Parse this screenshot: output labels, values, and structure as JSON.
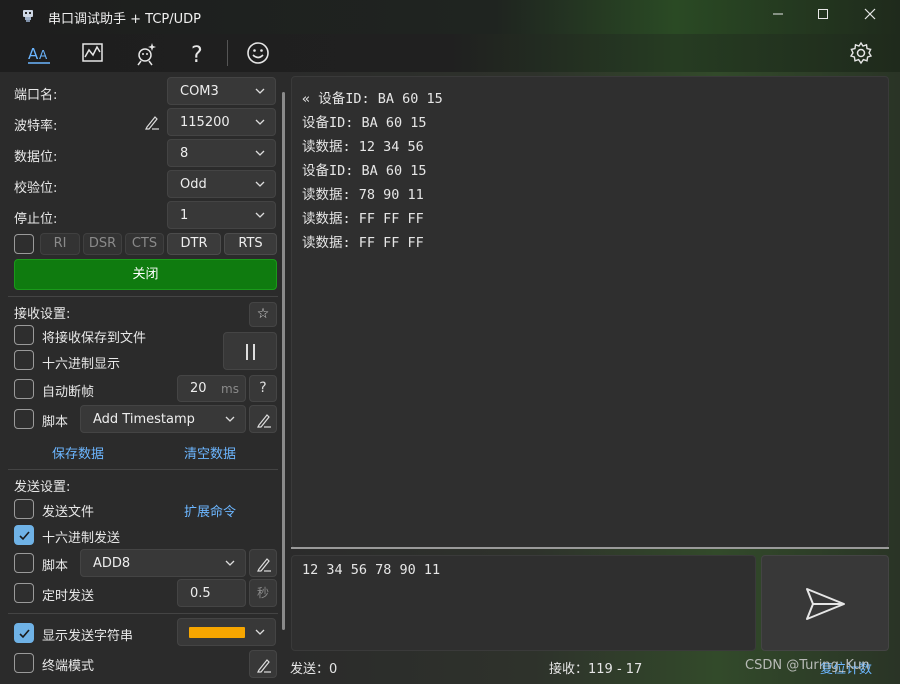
{
  "window": {
    "title": "串口调试助手 + TCP/UDP",
    "controls": [
      "minimize-icon",
      "maximize-icon",
      "close-icon"
    ]
  },
  "toolbar": {
    "icons": [
      "font-icon",
      "chart-icon",
      "magic-icon",
      "help-icon",
      "smiley-icon",
      "gear-icon"
    ],
    "help_glyph": "?"
  },
  "serial": {
    "port_label": "端口名:",
    "port_value": "COM3",
    "baud_label": "波特率:",
    "baud_value": "115200",
    "databits_label": "数据位:",
    "databits_value": "8",
    "parity_label": "校验位:",
    "parity_value": "Odd",
    "stopbits_label": "停止位:",
    "stopbits_value": "1",
    "signals": [
      "RI",
      "DSR",
      "CTS",
      "DTR",
      "RTS"
    ],
    "close_label": "关闭"
  },
  "receive_settings": {
    "title": "接收设置:",
    "save_to_file": "将接收保存到文件",
    "hex_display": "十六进制显示",
    "auto_frame": "自动断帧",
    "auto_frame_value": "20",
    "auto_frame_unit": "ms",
    "help_glyph": "?",
    "script_label": "脚本",
    "script_value": "Add Timestamp",
    "save_data": "保存数据",
    "clear_data": "清空数据"
  },
  "send_settings": {
    "title": "发送设置:",
    "send_file": "发送文件",
    "extend_cmd": "扩展命令",
    "hex_send": "十六进制发送",
    "hex_send_checked": true,
    "script_label": "脚本",
    "script_value": "ADD8",
    "timed_send": "定时发送",
    "timed_value": "0.5",
    "timed_unit": "秒",
    "show_send_string": "显示发送字符串",
    "show_send_checked": true,
    "send_color": "#f7a600",
    "terminal_mode": "终端模式"
  },
  "receive_lines": [
    "« 设备ID: BA 60 15",
    "设备ID: BA 60 15",
    "读数据: 12 34 56",
    "设备ID: BA 60 15",
    "读数据: 78 90 11",
    "读数据: FF FF FF",
    "读数据: FF FF FF"
  ],
  "send_text": "12 34 56 78 90 11",
  "status": {
    "sent": "发送：0",
    "received": "接收：119 - 17",
    "reset_count": "复位计数"
  },
  "watermark": "CSDN @Turing_Kun",
  "colors": {
    "close_button": "#0f7b0f",
    "link": "#6cb6ff",
    "checkbox_checked": "#6fb2e6"
  }
}
